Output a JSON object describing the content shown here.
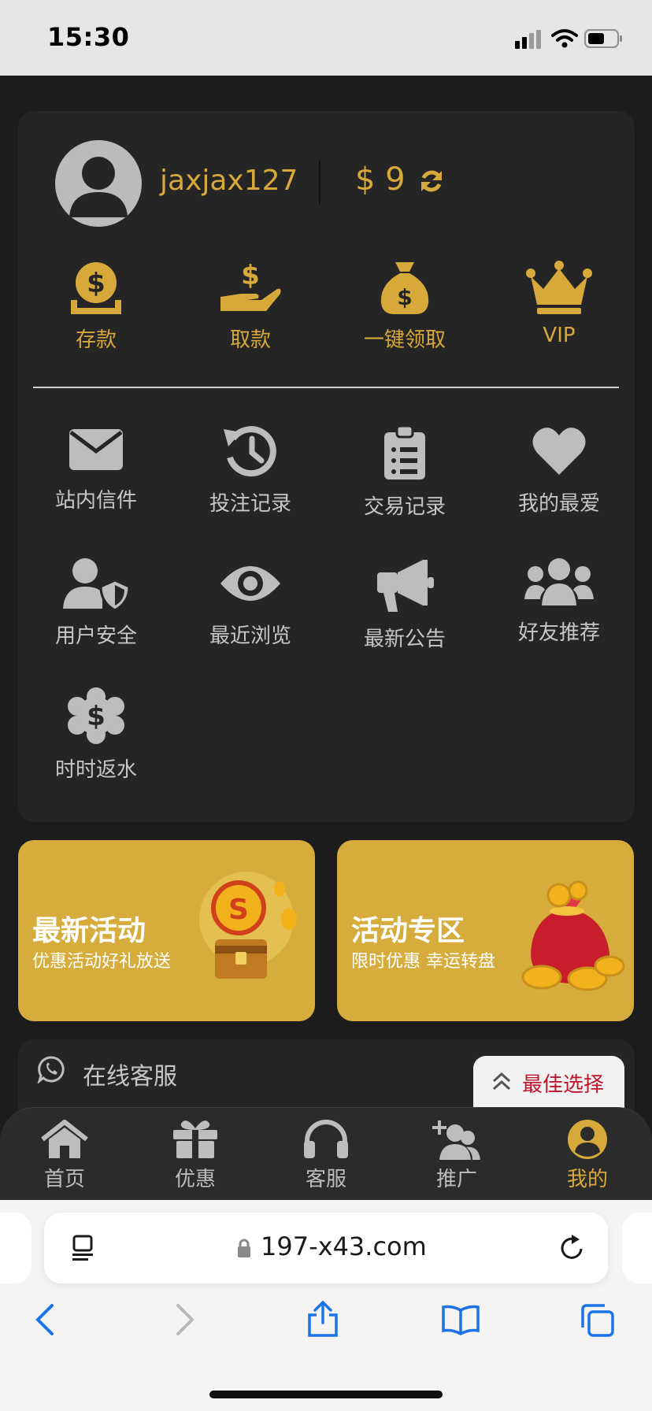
{
  "status_bar": {
    "time": "15:30"
  },
  "user": {
    "username": "jaxjax127",
    "balance": "$ 9"
  },
  "quick_actions": [
    {
      "label": "存款",
      "icon": "deposit-coin-icon"
    },
    {
      "label": "取款",
      "icon": "withdraw-hand-icon"
    },
    {
      "label": "一键领取",
      "icon": "money-bag-icon"
    },
    {
      "label": "VIP",
      "icon": "crown-icon"
    }
  ],
  "menu": [
    {
      "label": "站内信件",
      "icon": "envelope-icon"
    },
    {
      "label": "投注记录",
      "icon": "history-icon"
    },
    {
      "label": "交易记录",
      "icon": "clipboard-list-icon"
    },
    {
      "label": "我的最爱",
      "icon": "heart-icon"
    },
    {
      "label": "用户安全",
      "icon": "user-shield-icon"
    },
    {
      "label": "最近浏览",
      "icon": "eye-icon"
    },
    {
      "label": "最新公告",
      "icon": "megaphone-icon"
    },
    {
      "label": "好友推荐",
      "icon": "users-icon"
    },
    {
      "label": "时时返水",
      "icon": "dollar-badge-icon"
    }
  ],
  "banners": [
    {
      "title": "最新活动",
      "subtitle": "优惠活动好礼放送"
    },
    {
      "title": "活动专区",
      "subtitle": "限时优惠 幸运转盘"
    }
  ],
  "support": {
    "label": "在线客服"
  },
  "best_choice": {
    "label": "最佳选择"
  },
  "tabbar": [
    {
      "label": "首页",
      "icon": "home-icon"
    },
    {
      "label": "优惠",
      "icon": "gift-icon"
    },
    {
      "label": "客服",
      "icon": "headset-icon"
    },
    {
      "label": "推广",
      "icon": "user-plus-icon"
    },
    {
      "label": "我的",
      "icon": "user-circle-icon",
      "active": true
    }
  ],
  "browser": {
    "url": "197-x43.com"
  },
  "colors": {
    "gold": "#d7a93b",
    "background": "#1c1c1c",
    "card": "#252525",
    "banner": "#d6ad3c",
    "accent_red": "#c0142c"
  }
}
